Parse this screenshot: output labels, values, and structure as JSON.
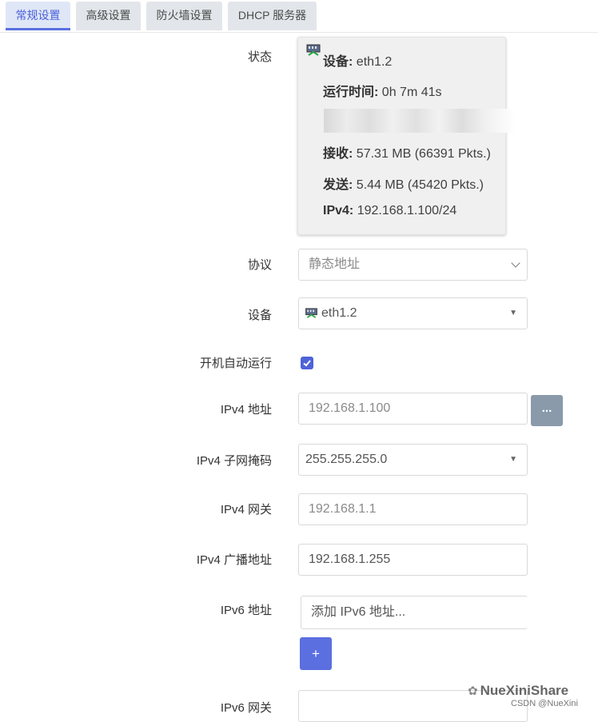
{
  "tabs": [
    {
      "label": "常规设置",
      "active": true
    },
    {
      "label": "高级设置",
      "active": false
    },
    {
      "label": "防火墙设置",
      "active": false
    },
    {
      "label": "DHCP 服务器",
      "active": false
    }
  ],
  "status": {
    "label": "状态",
    "device_key": "设备:",
    "device_val": "eth1.2",
    "uptime_key": "运行时间:",
    "uptime_val": "0h 7m 41s",
    "rx_key": "接收:",
    "rx_val": "57.31 MB (66391 Pkts.)",
    "tx_key": "发送:",
    "tx_val": "5.44 MB (45420 Pkts.)",
    "ipv4_key": "IPv4:",
    "ipv4_val": "192.168.1.100/24"
  },
  "protocol": {
    "label": "协议",
    "value": "静态地址"
  },
  "device": {
    "label": "设备",
    "value": "eth1.2"
  },
  "autostart": {
    "label": "开机自动运行",
    "checked": true
  },
  "ipv4_addr": {
    "label": "IPv4 地址",
    "placeholder": "192.168.1.100",
    "more_button": "..."
  },
  "ipv4_mask": {
    "label": "IPv4 子网掩码",
    "value": "255.255.255.0"
  },
  "ipv4_gw": {
    "label": "IPv4 网关",
    "placeholder": "192.168.1.1"
  },
  "ipv4_bcast": {
    "label": "IPv4 广播地址",
    "value": "192.168.1.255"
  },
  "ipv6_addr": {
    "label": "IPv6 地址",
    "placeholder": "添加 IPv6 地址...",
    "add_button": "+"
  },
  "ipv6_gw": {
    "label": "IPv6 网关"
  },
  "watermark": {
    "brand": "NueXiniShare",
    "sub": "CSDN @NueXini"
  },
  "colors": {
    "accent": "#5b6fe0",
    "tab_bg": "#e2e6ea",
    "status_bg": "#f0f0f0"
  }
}
